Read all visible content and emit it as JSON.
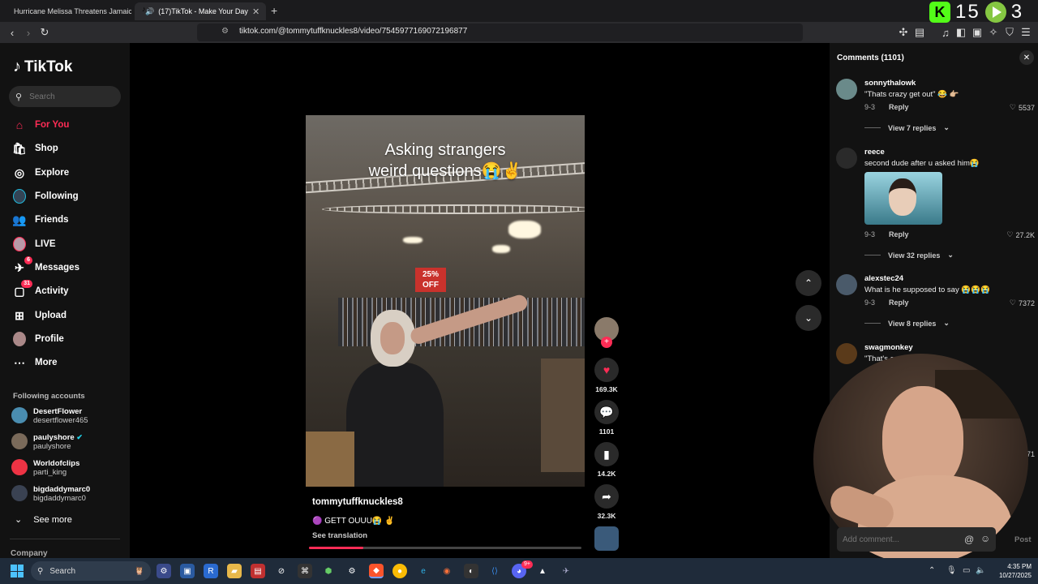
{
  "browser": {
    "tabs": [
      {
        "label": "Hurricane Melissa Threatens Jamaica"
      },
      {
        "label": "(17)TikTok - Make Your Day"
      }
    ],
    "url": "tiktok.com/@tommytuffknuckles8/video/7545977169072196877"
  },
  "stream_overlay": {
    "kick_count": "15",
    "rumble_count": "3"
  },
  "sidebar": {
    "logo": "TikTok",
    "search_placeholder": "Search",
    "nav": [
      {
        "label": "For You",
        "icon": "home-icon"
      },
      {
        "label": "Shop",
        "icon": "shop-icon"
      },
      {
        "label": "Explore",
        "icon": "compass-icon"
      },
      {
        "label": "Following",
        "icon": "avatar-icon"
      },
      {
        "label": "Friends",
        "icon": "friends-icon"
      },
      {
        "label": "LIVE",
        "icon": "live-avatar-icon"
      },
      {
        "label": "Messages",
        "icon": "messages-icon",
        "badge": "6"
      },
      {
        "label": "Activity",
        "icon": "activity-icon",
        "badge": "31"
      },
      {
        "label": "Upload",
        "icon": "upload-icon"
      },
      {
        "label": "Profile",
        "icon": "profile-avatar-icon"
      },
      {
        "label": "More",
        "icon": "more-icon"
      }
    ],
    "following_title": "Following accounts",
    "following_accounts": [
      {
        "name": "DesertFlower",
        "handle": "desertflower465"
      },
      {
        "name": "paulyshore",
        "handle": "paulyshore",
        "verified": true
      },
      {
        "name": "Worldofclips",
        "handle": "parti_king"
      },
      {
        "name": "bigdaddymarc0",
        "handle": "bigdaddymarc0"
      }
    ],
    "see_more": "See more",
    "company": "Company"
  },
  "video": {
    "caption_line1": "Asking strangers",
    "caption_line2": "weird questions😭✌️",
    "sale_sign": "25% OFF",
    "author": "tommytuffknuckles8",
    "description": "🟣 GETT OUUU😭 ✌️",
    "see_translation": "See translation",
    "progress": 0.2
  },
  "actions": {
    "likes": "169.3K",
    "comments": "1101",
    "saves": "14.2K",
    "shares": "32.3K"
  },
  "comments": {
    "title": "Comments (1101)",
    "items": [
      {
        "user": "sonnythalowk",
        "text": "\"Thats crazy get out\" 😂 👉🏼",
        "date": "9-3",
        "reply": "Reply",
        "likes": "5537",
        "replies": "View 7 replies"
      },
      {
        "user": "reece",
        "text": "second dude after u asked him😭",
        "date": "9-3",
        "reply": "Reply",
        "likes": "27.2K",
        "replies": "View 32 replies"
      },
      {
        "user": "alexstec24",
        "text": "What is he supposed to say 😭😭😭",
        "date": "9-3",
        "reply": "Reply",
        "likes": "7372",
        "replies": "View 8 replies"
      },
      {
        "user": "swagmonkey",
        "text": "\"That's crazy get out\"",
        "likes": "5971"
      }
    ],
    "input_placeholder": "Add comment...",
    "post_label": "Post"
  },
  "taskbar": {
    "search_label": "Search",
    "time": "4:35 PM",
    "date": "10/27/2025",
    "discord_badge": "9+"
  },
  "colors": {
    "accent": "#fe2c55",
    "kick": "#53fc18",
    "rumble": "#85c742"
  }
}
